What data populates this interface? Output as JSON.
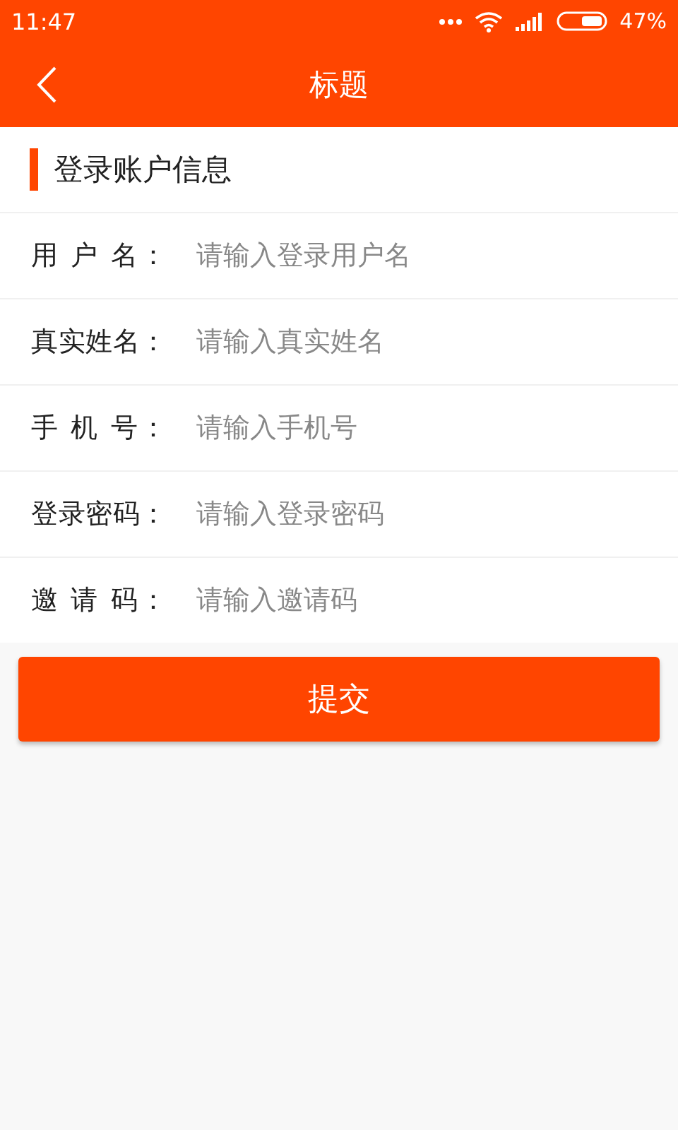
{
  "status_bar": {
    "time": "11:47",
    "battery": "47%"
  },
  "header": {
    "title": "标题"
  },
  "section": {
    "title": "登录账户信息"
  },
  "fields": [
    {
      "label": "用 户 名：",
      "placeholder": "请输入登录用户名"
    },
    {
      "label": "真实姓名：",
      "placeholder": "请输入真实姓名"
    },
    {
      "label": "手 机 号：",
      "placeholder": "请输入手机号"
    },
    {
      "label": "登录密码：",
      "placeholder": "请输入登录密码"
    },
    {
      "label": "邀 请 码：",
      "placeholder": "请输入邀请码"
    }
  ],
  "submit": {
    "label": "提交"
  }
}
